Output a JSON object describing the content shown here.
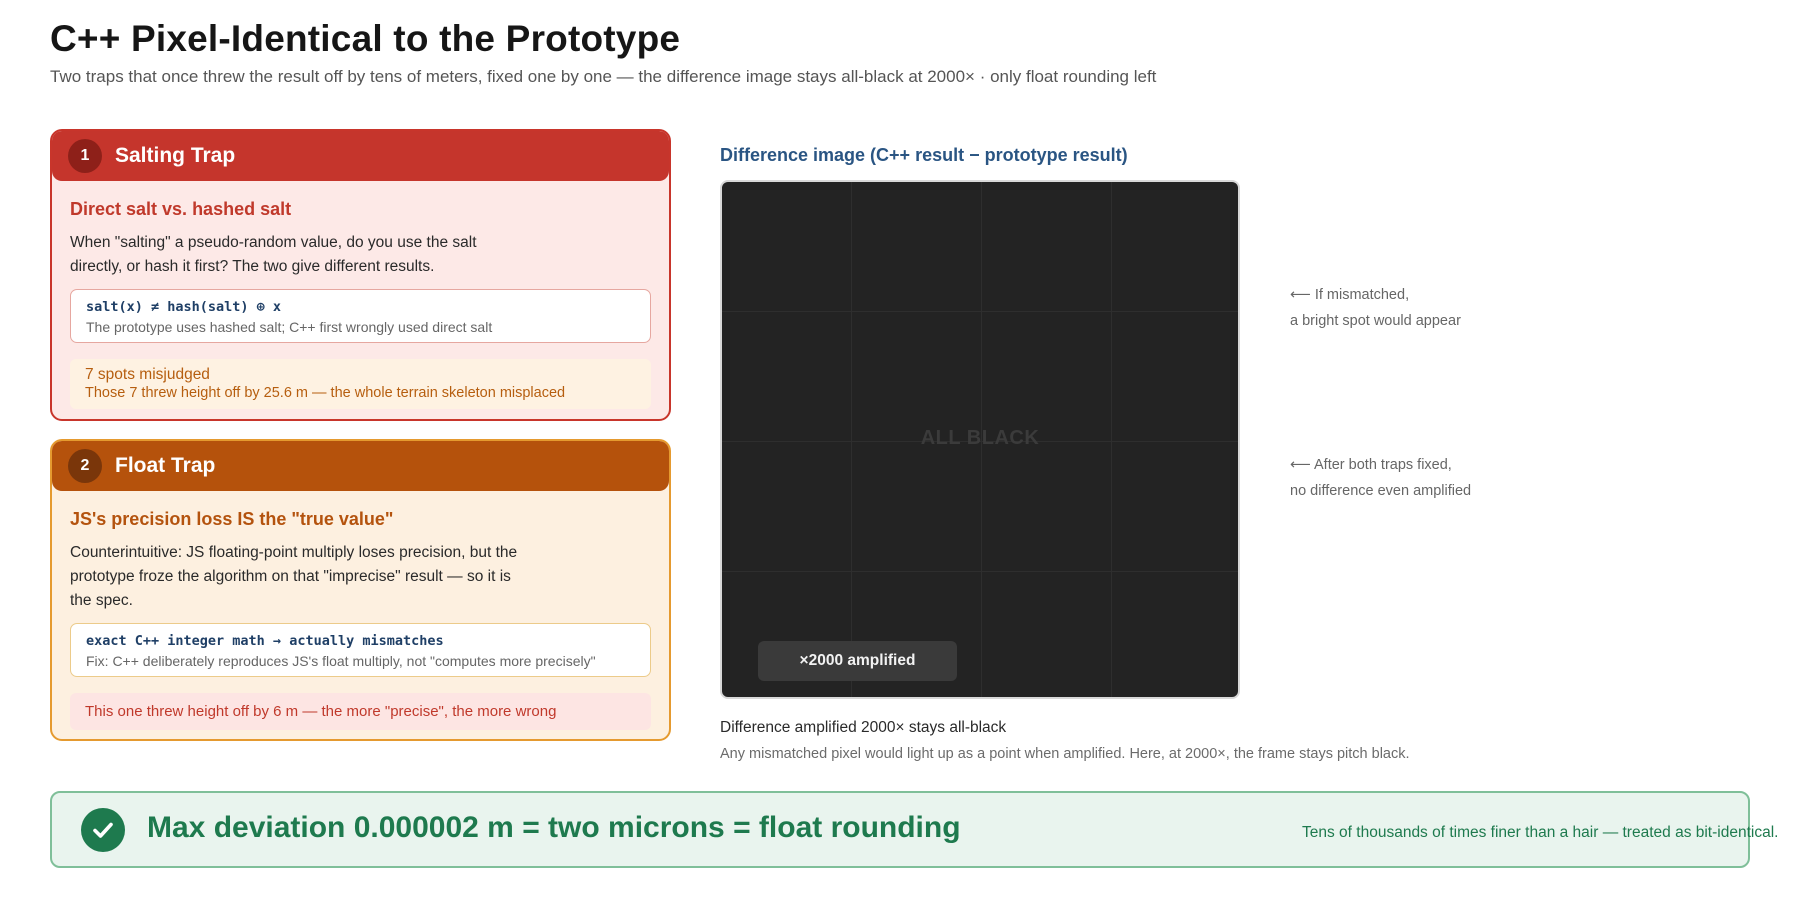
{
  "header": {
    "title": "C++ Pixel-Identical to the Prototype",
    "subtitle": "Two traps that once threw the result off by tens of meters, fixed one by one — the difference image stays all-black at 2000× · only float rounding left"
  },
  "traps": [
    {
      "number": "1",
      "title": "Salting Trap",
      "heading": "Direct salt vs. hashed salt",
      "description": "When \"salting\" a pseudo-random value, do you use the salt directly, or hash it first? The two give different results.",
      "code": "salt(x) ≠ hash(salt) ⊕ x",
      "code_note": "The prototype uses hashed salt; C++ first wrongly used direct salt",
      "warning_title": "7 spots misjudged",
      "warning_detail": "Those 7 threw height off by 25.6 m — the whole terrain skeleton misplaced"
    },
    {
      "number": "2",
      "title": "Float Trap",
      "heading": "JS's precision loss IS the \"true value\"",
      "description": "Counterintuitive: JS floating-point multiply loses precision, but the prototype froze the algorithm on that \"imprecise\" result — so it is the spec.",
      "code": "exact C++ integer math → actually mismatches",
      "code_note": "Fix: C++ deliberately reproduces JS's float multiply, not \"computes more precisely\"",
      "warning_detail": "This one threw height off by 6 m — the more \"precise\", the more wrong"
    }
  ],
  "diff_panel": {
    "title": "Difference image (C++ result − prototype result)",
    "center_label": "ALL BLACK",
    "badge": "×2000 amplified",
    "annotation_1_line1": "⟵ If mismatched,",
    "annotation_1_line2": "a bright spot would appear",
    "annotation_2_line1": "⟵ After both traps fixed,",
    "annotation_2_line2": "no difference even amplified",
    "caption": "Difference amplified 2000× stays all-black",
    "caption_detail": "Any mismatched pixel would light up as a point when amplified. Here, at 2000×, the frame stays pitch black."
  },
  "banner": {
    "icon": "check-icon",
    "headline": "Max deviation 0.000002 m = two microns = float rounding",
    "note": "Tens of thousands of times finer than a hair — treated as bit-identical."
  },
  "colors": {
    "trap1_accent": "#c5352c",
    "trap2_accent": "#b5520c",
    "diff_background": "#232323",
    "success": "#1e7a4e"
  }
}
